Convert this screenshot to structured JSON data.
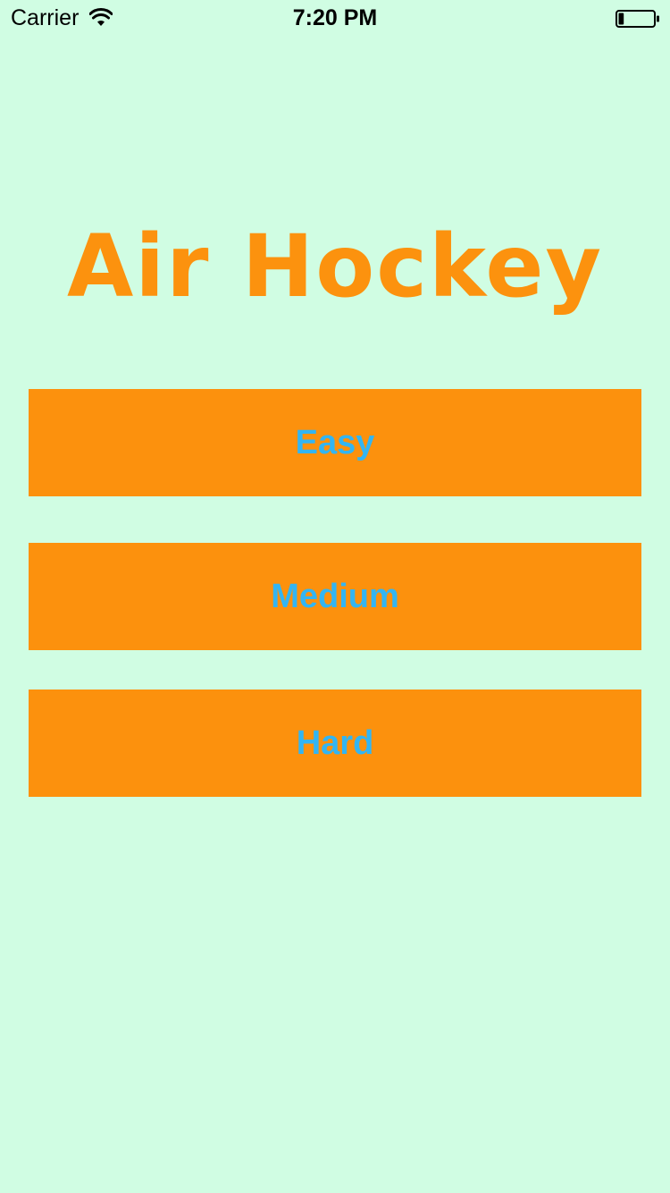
{
  "status_bar": {
    "carrier": "Carrier",
    "time": "7:20 PM",
    "wifi_icon": "wifi-icon",
    "battery_icon": "battery-icon",
    "battery_level": 0.15
  },
  "title": "Air Hockey",
  "buttons": [
    {
      "label": "Easy"
    },
    {
      "label": "Medium"
    },
    {
      "label": "Hard"
    }
  ],
  "colors": {
    "background": "#d0fde3",
    "accent": "#fc920e",
    "button_text": "#33b5f2"
  }
}
